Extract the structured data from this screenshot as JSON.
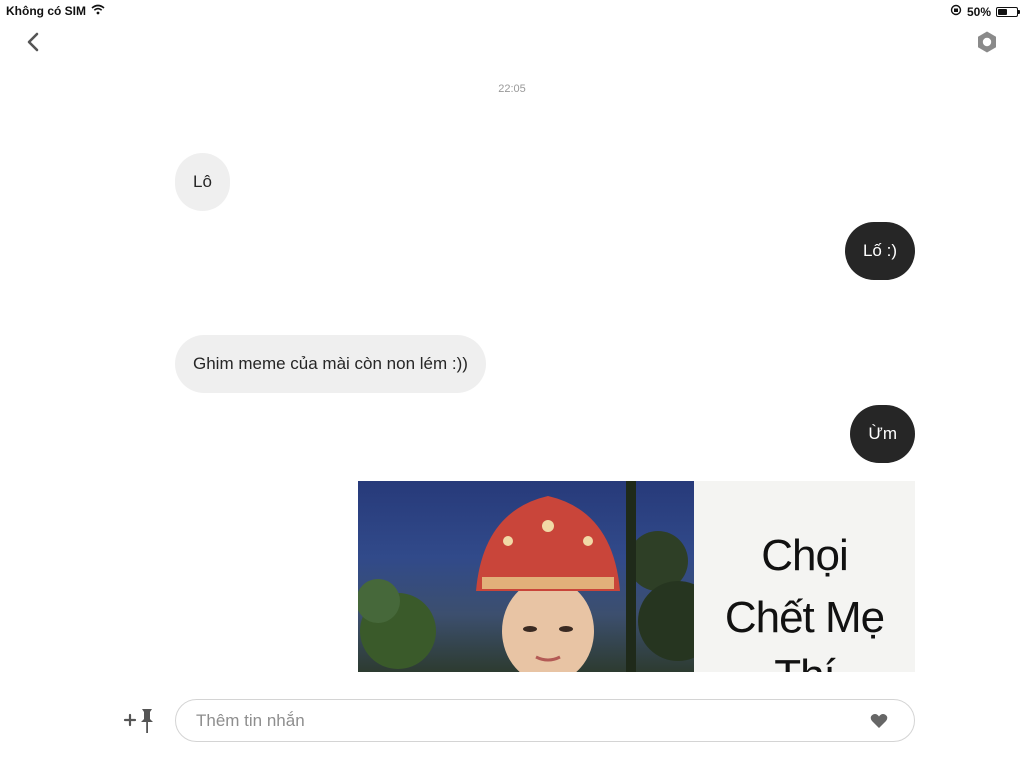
{
  "status_bar": {
    "carrier": "Không có SIM",
    "battery_percent_label": "50%",
    "battery_level": 0.5
  },
  "nav": {
    "back_icon": "chevron-left-icon",
    "settings_icon": "gear-icon"
  },
  "conversation": {
    "timestamp": "22:05",
    "messages": [
      {
        "direction": "incoming",
        "text": "Lô"
      },
      {
        "direction": "outgoing",
        "text": "Lố :)"
      },
      {
        "direction": "incoming",
        "text": "Ghim meme của mài còn non lém :))"
      },
      {
        "direction": "outgoing",
        "text": "Ừm"
      }
    ],
    "image_message": {
      "direction": "outgoing",
      "caption_lines": [
        "Chọi",
        "Chết Mẹ",
        "Thí"
      ]
    }
  },
  "composer": {
    "placeholder": "Thêm tin nhắn",
    "value": "",
    "attach_icon": "plus-pin-icon",
    "like_icon": "heart-icon"
  },
  "colors": {
    "incoming_bubble": "#efefef",
    "outgoing_bubble": "#262626",
    "timestamp": "#999999"
  }
}
